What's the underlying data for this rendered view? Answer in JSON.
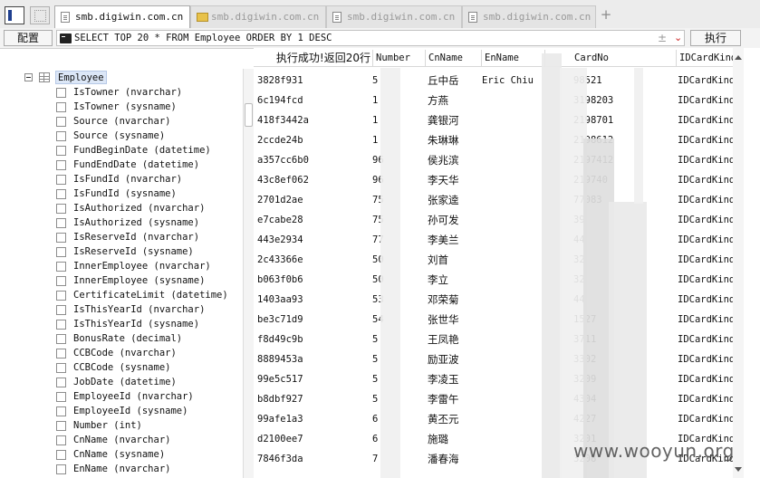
{
  "tabs": [
    {
      "label": "smb.digiwin.com.cn",
      "icon": "document-icon",
      "active": true
    },
    {
      "label": "smb.digiwin.com.cn",
      "icon": "folder-icon",
      "active": false
    },
    {
      "label": "smb.digiwin.com.cn",
      "icon": "document-icon",
      "active": false
    },
    {
      "label": "smb.digiwin.com.cn",
      "icon": "document-icon",
      "active": false
    }
  ],
  "toolbar": {
    "config_label": "配置",
    "execute_label": "执行",
    "query": "SELECT TOP 20 * FROM Employee ORDER BY 1 DESC",
    "plus_glyph": "±",
    "chevron_glyph": "⌄"
  },
  "tree": {
    "table": "Employee",
    "fields": [
      "IsTowner (nvarchar)",
      "IsTowner (sysname)",
      "Source (nvarchar)",
      "Source (sysname)",
      "FundBeginDate (datetime)",
      "FundEndDate (datetime)",
      "IsFundId (nvarchar)",
      "IsFundId (sysname)",
      "IsAuthorized (nvarchar)",
      "IsAuthorized (sysname)",
      "IsReserveId (nvarchar)",
      "IsReserveId (sysname)",
      "InnerEmployee (nvarchar)",
      "InnerEmployee (sysname)",
      "CertificateLimit (datetime)",
      "IsThisYearId (nvarchar)",
      "IsThisYearId (sysname)",
      "BonusRate (decimal)",
      "CCBCode (nvarchar)",
      "CCBCode (sysname)",
      "JobDate (datetime)",
      "EmployeeId (nvarchar)",
      "EmployeeId (sysname)",
      "Number (int)",
      "CnName (nvarchar)",
      "CnName (sysname)",
      "EnName (nvarchar)"
    ]
  },
  "results": {
    "status": "执行成功!返回20行",
    "columns": [
      "",
      "Number",
      "CnName",
      "EnName",
      "CardNo",
      "IDCardKind"
    ],
    "rows": [
      {
        "id": "3828f931",
        "number": "5",
        "cnname": "丘中岳",
        "enname": "Eric Chiu",
        "cardno": "98521",
        "kind": "IDCardKind"
      },
      {
        "id": "6c194fcd",
        "number": "1",
        "cnname": "方燕",
        "enname": "",
        "cardno": "3198203",
        "kind": "IDCardKind"
      },
      {
        "id": "418f3442a",
        "number": "1",
        "cnname": "龚银河",
        "enname": "",
        "cardno": "2198701",
        "kind": "IDCardKind"
      },
      {
        "id": "2ccde24b",
        "number": "1",
        "cnname": "朱琳琳",
        "enname": "",
        "cardno": "2198612",
        "kind": "IDCardKind"
      },
      {
        "id": "a357cc6b0",
        "number": "96",
        "cnname": "侯兆滨",
        "enname": "",
        "cardno": "2197412",
        "kind": "IDCardKind"
      },
      {
        "id": "43c8ef062",
        "number": "96",
        "cnname": "李天华",
        "enname": "",
        "cardno": "219740",
        "kind": "IDCardKind"
      },
      {
        "id": "2701d2ae",
        "number": "75",
        "cnname": "张家逵",
        "enname": "",
        "cardno": "77083",
        "kind": "IDCardKind"
      },
      {
        "id": "e7cabe28",
        "number": "75",
        "cnname": "孙可发",
        "enname": "",
        "cardno": "39",
        "kind": "IDCardKind"
      },
      {
        "id": "443e2934",
        "number": "77",
        "cnname": "李美兰",
        "enname": "",
        "cardno": "44",
        "kind": "IDCardKind"
      },
      {
        "id": "2c43366e",
        "number": "50",
        "cnname": "刘首",
        "enname": "",
        "cardno": "32",
        "kind": "IDCardKind"
      },
      {
        "id": "b063f0b6",
        "number": "50",
        "cnname": "李立",
        "enname": "",
        "cardno": "32",
        "kind": "IDCardKind"
      },
      {
        "id": "1403aa93",
        "number": "53",
        "cnname": "邓荣菊",
        "enname": "",
        "cardno": "44",
        "kind": "IDCardKind"
      },
      {
        "id": "be3c71d9",
        "number": "54",
        "cnname": "张世华",
        "enname": "",
        "cardno": "1527",
        "kind": "IDCardKind"
      },
      {
        "id": "f8d49c9b",
        "number": "5",
        "cnname": "王凤艳",
        "enname": "",
        "cardno": "3711",
        "kind": "IDCardKind"
      },
      {
        "id": "8889453a",
        "number": "5",
        "cnname": "励亚波",
        "enname": "",
        "cardno": "3302",
        "kind": "IDCardKind"
      },
      {
        "id": "99e5c517",
        "number": "5",
        "cnname": "李凌玉",
        "enname": "",
        "cardno": "3209",
        "kind": "IDCardKind"
      },
      {
        "id": "b8dbf927",
        "number": "5",
        "cnname": "李雷午",
        "enname": "",
        "cardno": "4304",
        "kind": "IDCardKind"
      },
      {
        "id": "99afe1a3",
        "number": "6",
        "cnname": "黄丕元",
        "enname": "",
        "cardno": "4227",
        "kind": "IDCardKind"
      },
      {
        "id": "d2100ee7",
        "number": "6",
        "cnname": "施璐",
        "enname": "",
        "cardno": "3201",
        "kind": "IDCardKind"
      },
      {
        "id": "7846f3da",
        "number": "7",
        "cnname": "潘春海",
        "enname": "",
        "cardno": "3208",
        "kind": "IDCardKind"
      }
    ]
  },
  "watermark": "www.wooyun.org"
}
